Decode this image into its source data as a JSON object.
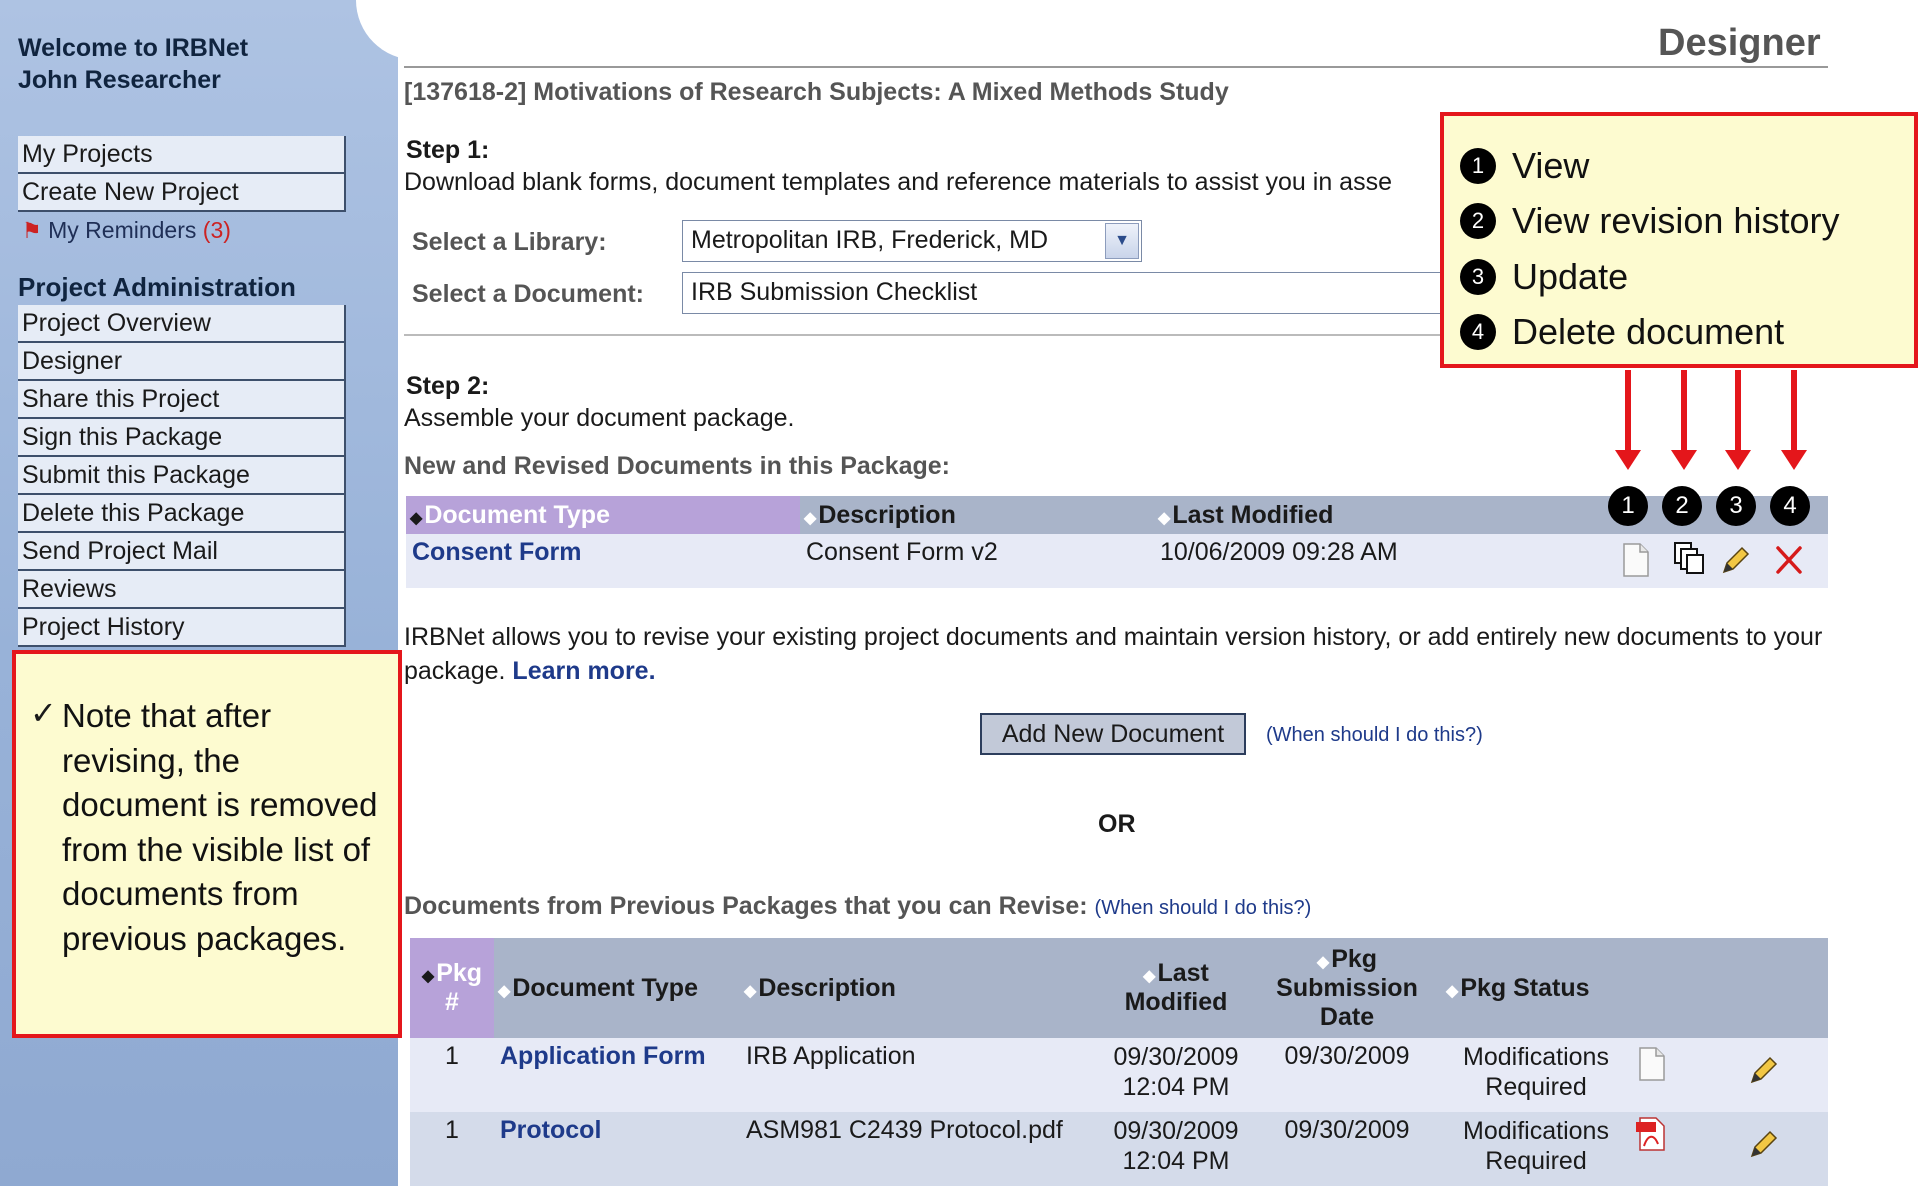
{
  "sidebar": {
    "welcome_line1": "Welcome to IRBNet",
    "welcome_line2": "John Researcher",
    "top_items": [
      {
        "label": "My Projects"
      },
      {
        "label": "Create New Project"
      }
    ],
    "reminders": {
      "label": "My Reminders",
      "count": "(3)"
    },
    "admin_heading": "Project Administration",
    "admin_items": [
      {
        "label": "Project Overview"
      },
      {
        "label": "Designer"
      },
      {
        "label": "Share this Project"
      },
      {
        "label": "Sign this Package"
      },
      {
        "label": "Submit this Package"
      },
      {
        "label": "Delete this Package"
      },
      {
        "label": "Send Project Mail"
      },
      {
        "label": "Reviews"
      },
      {
        "label": "Project History"
      }
    ],
    "note": {
      "check": "✓",
      "text": "Note that after revising, the document is removed from the visible list of documents from previous packages."
    }
  },
  "main": {
    "page_title": "Designer",
    "project_title": "[137618-2] Motivations of Research Subjects: A Mixed Methods Study",
    "step1": {
      "heading": "Step 1:",
      "description": "Download blank forms, document templates and reference materials to assist you in asse",
      "library_label": "Select a Library:",
      "library_value": "Metropolitan IRB, Frederick, MD",
      "document_label": "Select a Document:",
      "document_value": "IRB Submission Checklist"
    },
    "step2": {
      "heading": "Step 2:",
      "description": "Assemble your document package.",
      "new_docs_label": "New and Revised Documents in this Package:",
      "table_headers": [
        "Document Type",
        "Description",
        "Last Modified"
      ],
      "rows": [
        {
          "type": "Consent Form",
          "description": "Consent Form v2",
          "modified": "10/06/2009 09:28 AM"
        }
      ]
    },
    "paragraph": "IRBNet allows you to revise your existing project documents and maintain version history, or add entirely new documents to your package.",
    "learn_more": "Learn more.",
    "add_button": "Add New Document",
    "when_link": "(When should I do this?)",
    "or_text": "OR",
    "prev_label": "Documents from Previous Packages that you can Revise:",
    "prev_when_link": "(When should I do this?)",
    "prev_headers": {
      "pkg": "Pkg #",
      "type": "Document Type",
      "description": "Description",
      "modified": "Last Modified",
      "submission": "Pkg Submission Date",
      "status": "Pkg Status"
    },
    "prev_rows": [
      {
        "pkg": "1",
        "type": "Application Form",
        "description": "IRB Application",
        "modified_date": "09/30/2009",
        "modified_time": "12:04 PM",
        "submission": "09/30/2009",
        "status_line1": "Modifications",
        "status_line2": "Required",
        "file_icon": "document-icon"
      },
      {
        "pkg": "1",
        "type": "Protocol",
        "description": "ASM981 C2439 Protocol.pdf",
        "modified_date": "09/30/2009",
        "modified_time": "12:04 PM",
        "submission": "09/30/2009",
        "status_line1": "Modifications",
        "status_line2": "Required",
        "file_icon": "pdf-icon"
      }
    ]
  },
  "callout": {
    "items": [
      {
        "num": "1",
        "label": "View"
      },
      {
        "num": "2",
        "label": "View revision history"
      },
      {
        "num": "3",
        "label": "Update"
      },
      {
        "num": "4",
        "label": "Delete document"
      }
    ],
    "column_badges": [
      "1",
      "2",
      "3",
      "4"
    ]
  },
  "colors": {
    "accent_red": "#e4161b",
    "sidebar_blue": "#98b2d8",
    "link_blue": "#1e3a8a",
    "callout_yellow": "#fdfbd0"
  }
}
